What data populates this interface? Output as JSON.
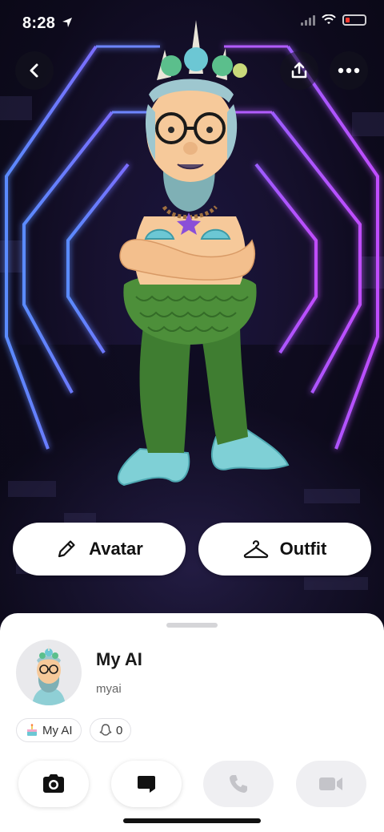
{
  "status_bar": {
    "time": "8:28",
    "battery_color": "#ff3b30"
  },
  "top_bar": {
    "back_icon": "chevron-left-icon",
    "share_icon": "share-upload-icon",
    "more_icon": "more-dots-icon"
  },
  "avatar_scene": {
    "character": "mermaid-avatar",
    "background": "neon-hexagon-tunnel"
  },
  "buttons": {
    "avatar_label": "Avatar",
    "outfit_label": "Outfit"
  },
  "profile": {
    "name": "My AI",
    "username": "myai",
    "chips": [
      {
        "icon": "cake-icon",
        "label": "My AI"
      },
      {
        "icon": "ghost-icon",
        "label": "0"
      }
    ]
  },
  "actions": [
    {
      "icon": "camera-icon",
      "enabled": true
    },
    {
      "icon": "chat-icon",
      "enabled": true
    },
    {
      "icon": "phone-icon",
      "enabled": false
    },
    {
      "icon": "video-icon",
      "enabled": false
    }
  ],
  "colors": {
    "neon_blue": "#4f7dff",
    "neon_purple": "#b04cff",
    "tail_green": "#4d8f3a",
    "fin_teal": "#7fd0d6"
  }
}
